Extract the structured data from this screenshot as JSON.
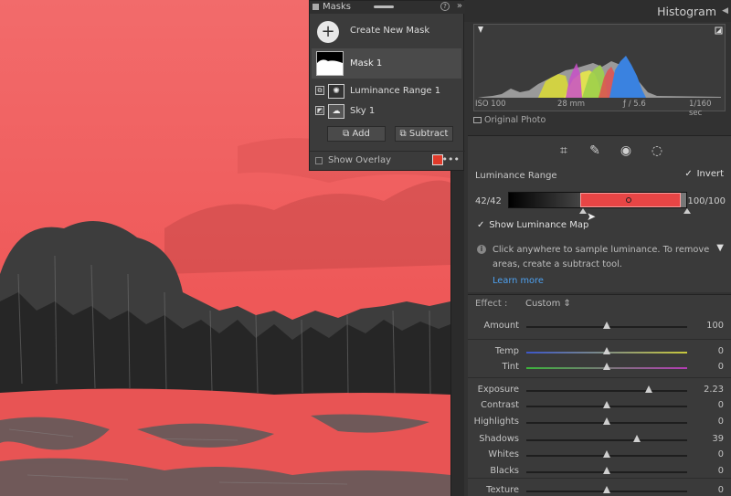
{
  "histogram": {
    "title": "Histogram",
    "iso": "ISO 100",
    "focal": "28 mm",
    "aperture": "ƒ / 5.6",
    "shutter": "1/160 sec",
    "original_photo": "Original Photo"
  },
  "masks": {
    "title": "Masks",
    "create_new": "Create New Mask",
    "mask1": "Mask 1",
    "components": [
      "Luminance Range 1",
      "Sky 1"
    ],
    "add": "Add",
    "subtract": "Subtract",
    "show_overlay": "Show Overlay",
    "overlay_color": "#e03a2a"
  },
  "luminance": {
    "title": "Luminance Range",
    "invert": "Invert",
    "left_value": "42/42",
    "right_value": "100/100",
    "show_map": "Show Luminance Map",
    "info": "Click anywhere to sample luminance. To remove areas, create a subtract tool.",
    "learn_more": "Learn more",
    "range_start": 0.42,
    "range_end": 1.0
  },
  "effect": {
    "label": "Effect :",
    "preset": "Custom"
  },
  "sliders": [
    {
      "label": "Amount",
      "value": "100",
      "pos": 0.5
    },
    {
      "label": "Temp",
      "value": "0",
      "pos": 0.5
    },
    {
      "label": "Tint",
      "value": "0",
      "pos": 0.5
    },
    {
      "label": "Exposure",
      "value": "2.23",
      "pos": 0.76
    },
    {
      "label": "Contrast",
      "value": "0",
      "pos": 0.5
    },
    {
      "label": "Highlights",
      "value": "0",
      "pos": 0.5
    },
    {
      "label": "Shadows",
      "value": "39",
      "pos": 0.69
    },
    {
      "label": "Whites",
      "value": "0",
      "pos": 0.5
    },
    {
      "label": "Blacks",
      "value": "0",
      "pos": 0.5
    },
    {
      "label": "Texture",
      "value": "0",
      "pos": 0.5
    }
  ],
  "colors": {
    "overlay_red": "#ee5a5a",
    "accent_blue": "#4ea1f0"
  }
}
